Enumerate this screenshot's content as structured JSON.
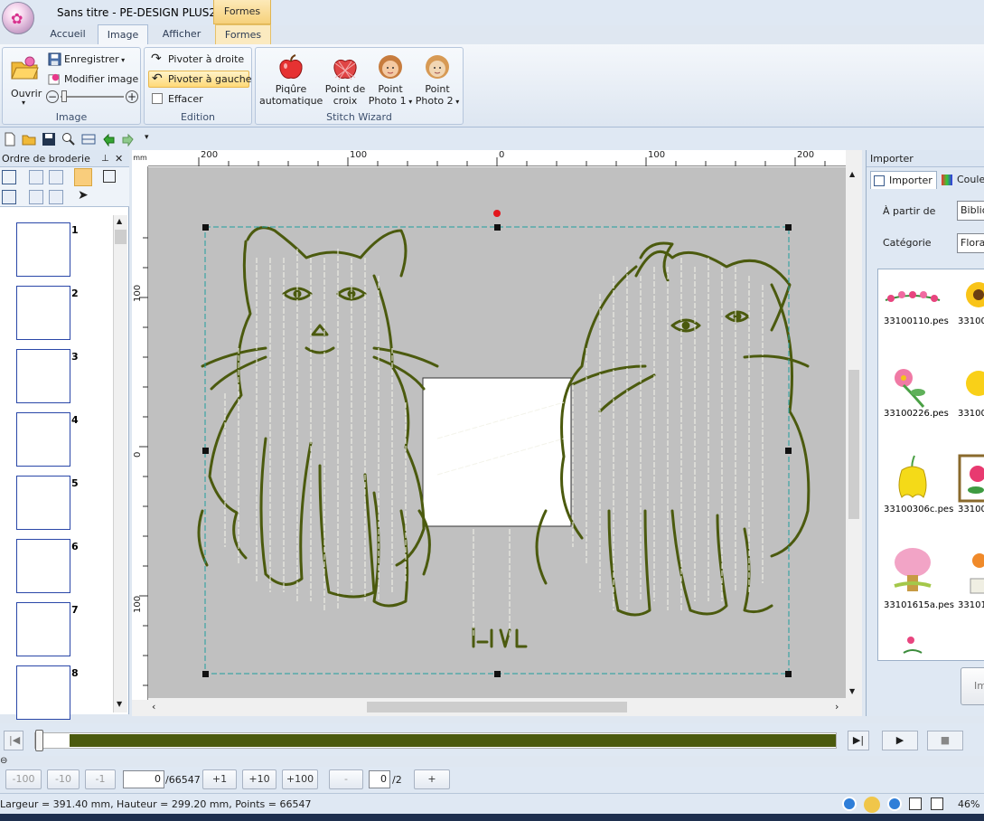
{
  "window": {
    "title": "Sans titre - PE-DESIGN PLUS2",
    "context_tab": "Formes"
  },
  "tabs": [
    "Accueil",
    "Image",
    "Afficher",
    "Formes"
  ],
  "ribbon": {
    "image_group": {
      "label": "Image",
      "open": "Ouvrir",
      "save": "Enregistrer",
      "modify": "Modifier image"
    },
    "edition_group": {
      "label": "Edition",
      "rotate_right": "Pivoter à droite",
      "rotate_left": "Pivoter à gauche",
      "erase": "Effacer"
    },
    "stitch_group": {
      "label": "Stitch Wizard",
      "auto_line1": "Piqûre",
      "auto_line2": "automatique",
      "cross_line1": "Point de",
      "cross_line2": "croix",
      "photo1_line1": "Point",
      "photo1_line2": "Photo 1",
      "photo2_line1": "Point",
      "photo2_line2": "Photo 2"
    }
  },
  "left_panel": {
    "title": "Ordre de broderie",
    "thumbnails": [
      "1",
      "2",
      "3",
      "4",
      "5",
      "6",
      "7",
      "8"
    ]
  },
  "rulers": {
    "unit": "mm",
    "top_labels": [
      "200",
      "100",
      "0",
      "100",
      "200"
    ],
    "left_labels": [
      "100",
      "0",
      "100"
    ]
  },
  "right_panel": {
    "title": "Importer",
    "tab_import": "Importer",
    "tab_color": "Couleur",
    "from_label": "À partir de",
    "from_value": "Bibliothèque",
    "category_label": "Catégorie",
    "category_value": "Floral",
    "items": [
      "33100110.pes",
      "33100",
      "33100226.pes",
      "33100",
      "33100306c.pes",
      "33100",
      "33101615a.pes",
      "33101"
    ],
    "import_button": "Importer"
  },
  "stepbar": {
    "minus100": "-100",
    "minus10": "-10",
    "minus1": "-1",
    "stitch_value": "0",
    "stitch_total": "/66547",
    "plus1": "+1",
    "plus10": "+10",
    "plus100": "+100",
    "color_minus": "-",
    "color_value": "0",
    "color_total": "/2",
    "color_plus": "+"
  },
  "status": {
    "dimensions": "Largeur = 391.40 mm, Hauteur = 299.20 mm, Points = 66547",
    "zoom": "46%"
  },
  "colors": {
    "thread": "#4b5a0e",
    "accent": "#f7d27c"
  }
}
